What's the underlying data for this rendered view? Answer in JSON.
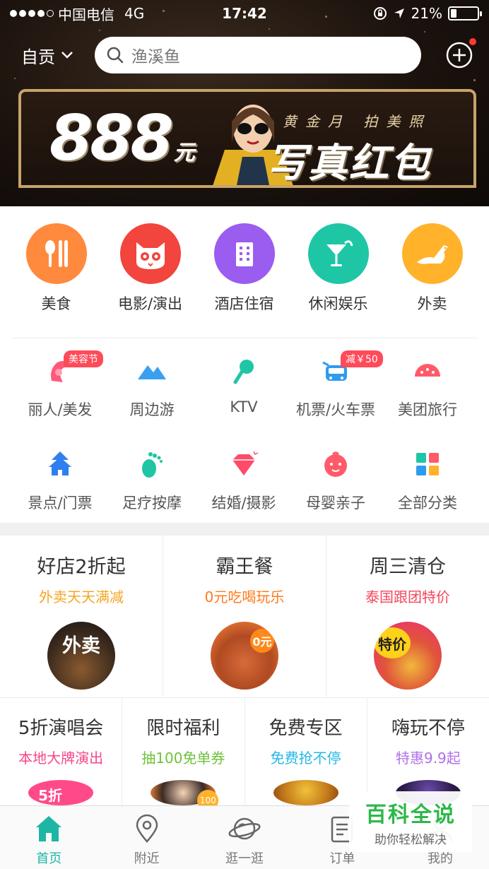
{
  "status_bar": {
    "carrier": "中国电信",
    "network": "4G",
    "time": "17:42",
    "battery": "21%",
    "battery_level": 0.21
  },
  "top_bar": {
    "city": "自贡",
    "search_placeholder": "渔溪鱼"
  },
  "banner": {
    "amount": "888",
    "unit": "元",
    "subtitle": "黄金月  拍美照",
    "title": "写真红包"
  },
  "main_categories": [
    {
      "label": "美食",
      "icon": "food-icon",
      "color": "#ff8a3d"
    },
    {
      "label": "电影/演出",
      "icon": "cat-movie-icon",
      "color": "#f2453d"
    },
    {
      "label": "酒店住宿",
      "icon": "hotel-icon",
      "color": "#9b5cf0"
    },
    {
      "label": "休闲娱乐",
      "icon": "cocktail-icon",
      "color": "#1ec6a6"
    },
    {
      "label": "外卖",
      "icon": "kangaroo-icon",
      "color": "#ffb22a"
    }
  ],
  "sub_categories_row1": [
    {
      "label": "丽人/美发",
      "icon": "beauty-icon",
      "tag": "美容节"
    },
    {
      "label": "周边游",
      "icon": "mountain-icon",
      "tag": ""
    },
    {
      "label": "KTV",
      "icon": "microphone-icon",
      "tag": ""
    },
    {
      "label": "机票/火车票",
      "icon": "train-icon",
      "tag": "减￥50"
    },
    {
      "label": "美团旅行",
      "icon": "travel-icon",
      "tag": ""
    }
  ],
  "sub_categories_row2": [
    {
      "label": "景点/门票",
      "icon": "pagoda-icon"
    },
    {
      "label": "足疗按摩",
      "icon": "foot-icon"
    },
    {
      "label": "结婚/摄影",
      "icon": "diamond-icon"
    },
    {
      "label": "母婴亲子",
      "icon": "baby-icon"
    },
    {
      "label": "全部分类",
      "icon": "grid-icon"
    }
  ],
  "promos_row1": [
    {
      "title": "好店2折起",
      "subtitle": "外卖天天满减",
      "subtitle_color": "#f5a623",
      "badge": "外卖"
    },
    {
      "title": "霸王餐",
      "subtitle": "0元吃喝玩乐",
      "subtitle_color": "#ff7a1a",
      "badge": "0元"
    },
    {
      "title": "周三清仓",
      "subtitle": "泰国跟团特价",
      "subtitle_color": "#f5465a",
      "badge": "特价"
    }
  ],
  "promos_row2": [
    {
      "title": "5折演唱会",
      "subtitle": "本地大牌演出",
      "subtitle_color": "#f5468a",
      "badge": "5折"
    },
    {
      "title": "限时福利",
      "subtitle": "抽100免单券",
      "subtitle_color": "#6fc23a",
      "badge": "100"
    },
    {
      "title": "免费专区",
      "subtitle": "免费抢不停",
      "subtitle_color": "#27b7e8"
    },
    {
      "title": "嗨玩不停",
      "subtitle": "特惠9.9起",
      "subtitle_color": "#b070e8"
    }
  ],
  "tabs": [
    {
      "label": "首页",
      "icon": "home-icon",
      "active": true
    },
    {
      "label": "附近",
      "icon": "location-icon",
      "active": false
    },
    {
      "label": "逛一逛",
      "icon": "planet-icon",
      "active": false
    },
    {
      "label": "订单",
      "icon": "order-icon",
      "active": false
    },
    {
      "label": "我的",
      "icon": "user-icon",
      "active": false
    }
  ],
  "watermark": {
    "title": "百科全说",
    "subtitle": "助你轻松解决"
  },
  "colors": {
    "accent": "#1db6a4",
    "header_bg": "#1b120d"
  }
}
